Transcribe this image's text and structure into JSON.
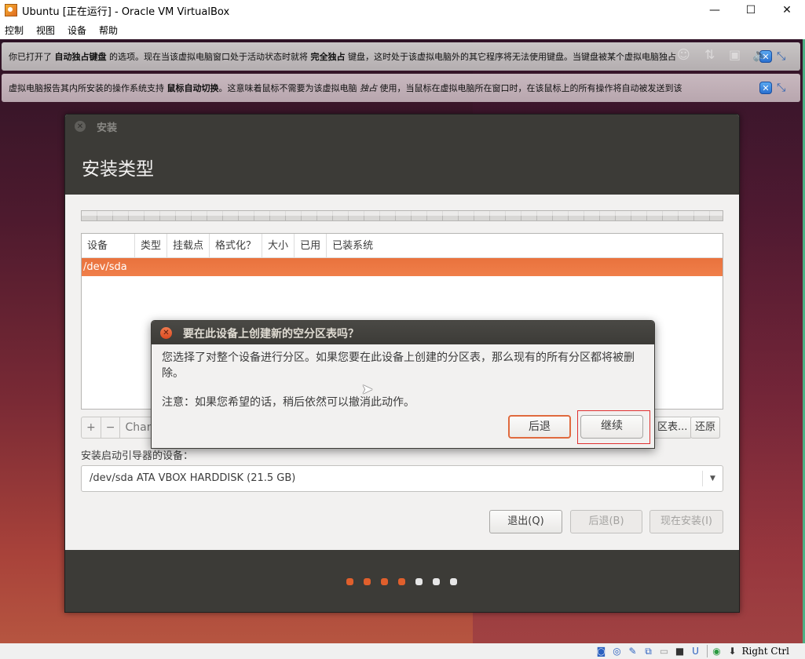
{
  "window": {
    "title": "Ubuntu [正在运行] - Oracle VM VirtualBox",
    "controls": {
      "minimize": "—",
      "maximize": "☐",
      "close": "✕"
    }
  },
  "menubar": [
    "控制",
    "视图",
    "设备",
    "帮助"
  ],
  "notices": [
    {
      "pre": "你已打开了 ",
      "bold1": "自动独占键盘",
      "mid": " 的选项。现在当该虚拟电脑窗口处于活动状态时就将 ",
      "bold2": "完全独占",
      "post": " 键盘，这时处于该虚拟电脑外的其它程序将无法使用键盘。当键盘被某个虚拟电脑独占"
    },
    {
      "pre": "虚拟电脑报告其内所安装的操作系统支持 ",
      "bold1": "鼠标自动切换",
      "mid": "。这意味着鼠标不需要为该虚拟电脑 ",
      "bold2": "独占",
      "post": " 使用，当鼠标在虚拟电脑所在窗口时，在该鼠标上的所有操作将自动被发送到该"
    }
  ],
  "installer": {
    "window_title": "安装",
    "page_title": "安装类型",
    "table": {
      "columns": [
        "设备",
        "类型",
        "挂载点",
        "格式化？",
        "大小",
        "已用",
        "已装系统"
      ],
      "rows": [
        "/dev/sda"
      ]
    },
    "toolbar": {
      "add": "+",
      "remove": "−",
      "change": "Chan"
    },
    "new_table_btn": "区表...",
    "revert_btn": "还原",
    "boot_label": "安装启动引导器的设备：",
    "boot_device": "/dev/sda  ATA VBOX HARDDISK (21.5 GB)",
    "buttons": {
      "quit": "退出(Q)",
      "back": "后退(B)",
      "install": "现在安装(I)"
    },
    "progress": {
      "total_steps": 7,
      "completed_steps": 4
    },
    "colors": {
      "accent": "#e9723d",
      "done_dot": "#e05f2c",
      "todo_dot": "#e6e6e6"
    }
  },
  "dialog": {
    "title": "要在此设备上创建新的空分区表吗？",
    "body": "您选择了对整个设备进行分区。如果您要在此设备上创建的分区表，那么现有的所有分区都将被删除。",
    "note": "注意：如果您希望的话，稍后依然可以撤消此动作。",
    "back_btn": "后退",
    "continue_btn": "继续"
  },
  "statusbar": {
    "host_key": "Right Ctrl"
  }
}
